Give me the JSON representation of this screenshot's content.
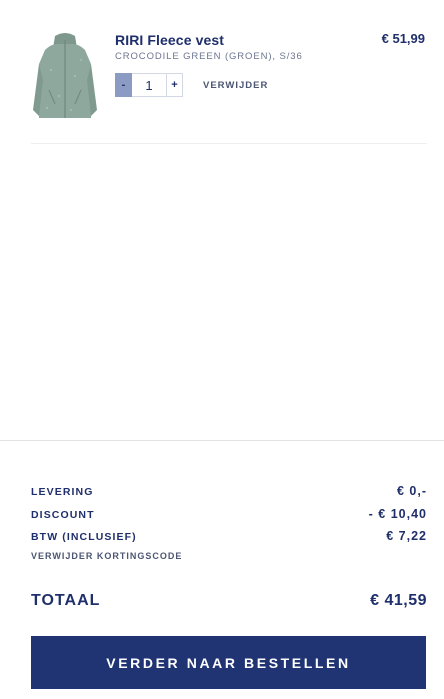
{
  "cart": {
    "items": [
      {
        "name": "RIRI Fleece vest",
        "variant": "CROCODILE GREEN (GROEN), S/36",
        "price": "€ 51,99",
        "quantity": "1",
        "minus_label": "-",
        "plus_label": "+",
        "remove_label": "VERWIJDER",
        "image_color": "#8fa89e"
      }
    ]
  },
  "summary": {
    "delivery_label": "LEVERING",
    "delivery_value": "€ 0,-",
    "discount_label": "DISCOUNT",
    "discount_value": "- € 10,40",
    "vat_label": "BTW (INCLUSIEF)",
    "vat_value": "€ 7,22",
    "remove_promo_label": "VERWIJDER KORTINGSCODE",
    "total_label": "TOTAAL",
    "total_value": "€ 41,59",
    "checkout_label": "VERDER NAAR BESTELLEN"
  },
  "colors": {
    "brand_navy": "#203474",
    "text_navy": "#1f2f6b",
    "minus_button": "#8c9bc4"
  }
}
